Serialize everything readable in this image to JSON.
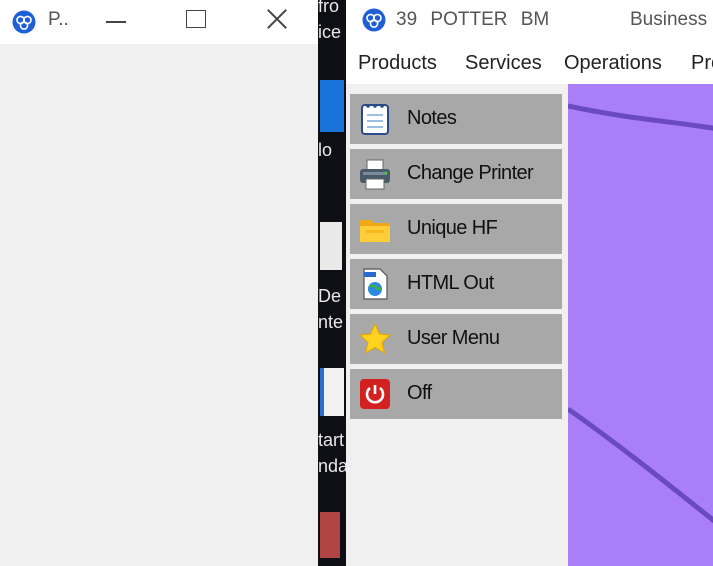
{
  "left_window": {
    "title": "P..",
    "controls": {
      "minimize": "minimize-icon",
      "maximize": "maximize-icon",
      "close": "close-icon"
    }
  },
  "desktop": {
    "texts": [
      "fro",
      "ice",
      "lo",
      "De",
      "nte",
      "tart",
      "nda"
    ]
  },
  "right_window": {
    "title": "39  POTTER  BM",
    "title_right": "Business",
    "menu": [
      "Products",
      "Services",
      "Operations",
      "Pro"
    ],
    "side_buttons": [
      {
        "label": "Notes",
        "icon": "notepad-icon"
      },
      {
        "label": "Change Printer",
        "icon": "printer-icon"
      },
      {
        "label": "Unique HF",
        "icon": "folder-icon"
      },
      {
        "label": "HTML Out",
        "icon": "html-file-icon"
      },
      {
        "label": "User Menu",
        "icon": "star-icon"
      },
      {
        "label": "Off",
        "icon": "power-icon"
      }
    ]
  },
  "colors": {
    "side_button_bg": "#a8a8a8",
    "canvas_bg": "#a97ef6",
    "canvas_line": "#6a4bbf",
    "app_icon": "#1f5fd6"
  }
}
